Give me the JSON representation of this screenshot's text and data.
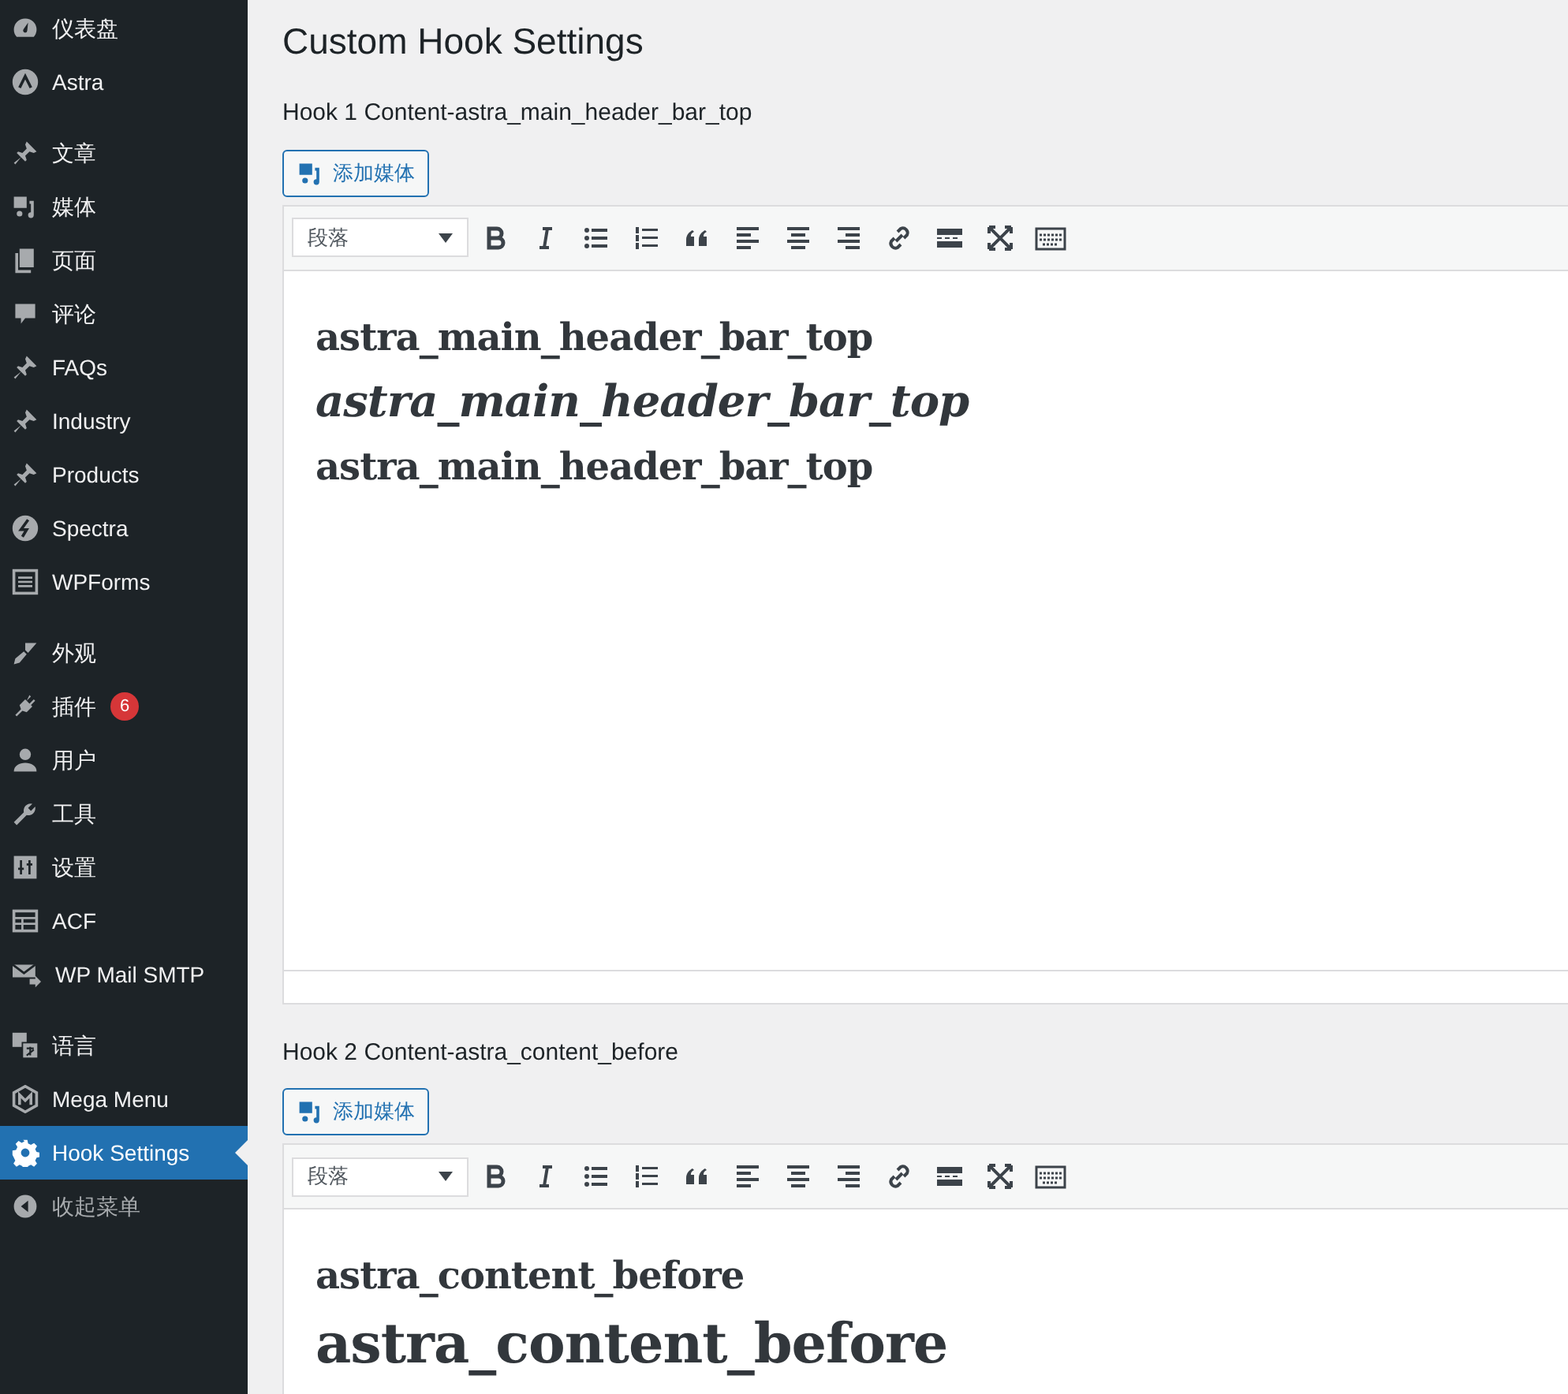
{
  "sidebar": {
    "menu_groups": [
      {
        "items": [
          {
            "label": "仪表盘",
            "selected": false
          },
          {
            "label": "Astra",
            "selected": false
          }
        ]
      },
      {
        "items": [
          {
            "label": "文章",
            "selected": false
          },
          {
            "label": "媒体",
            "selected": false
          },
          {
            "label": "页面",
            "selected": false
          },
          {
            "label": "评论",
            "selected": false
          },
          {
            "label": "FAQs",
            "selected": false
          },
          {
            "label": "Industry",
            "selected": false
          },
          {
            "label": "Products",
            "selected": false
          },
          {
            "label": "Spectra",
            "selected": false
          },
          {
            "label": "WPForms",
            "selected": false
          }
        ]
      },
      {
        "items": [
          {
            "label": "外观",
            "selected": false
          },
          {
            "label": "插件",
            "selected": false,
            "badge": "6"
          },
          {
            "label": "用户",
            "selected": false
          },
          {
            "label": "工具",
            "selected": false
          },
          {
            "label": "设置",
            "selected": false
          },
          {
            "label": "ACF",
            "selected": false
          },
          {
            "label": "WP Mail SMTP",
            "selected": false
          }
        ]
      },
      {
        "items": [
          {
            "label": "语言",
            "selected": false
          },
          {
            "label": "Mega Menu",
            "selected": false
          },
          {
            "label": "Hook Settings",
            "selected": true
          }
        ]
      }
    ],
    "collapse_label": "收起菜单"
  },
  "page": {
    "title": "Custom Hook Settings",
    "hooks": [
      {
        "label": "Hook 1 Content-astra_main_header_bar_top",
        "add_media": "添加媒体",
        "format": "段落",
        "paragraphs": [
          {
            "text": "astra_main_header_bar_top",
            "kind": "medium",
            "italic": false
          },
          {
            "text": "astra_main_header_bar_top",
            "kind": "large",
            "italic": true
          },
          {
            "text": "astra_main_header_bar_top",
            "kind": "medium",
            "italic": false
          }
        ]
      },
      {
        "label": "Hook 2 Content-astra_content_before",
        "add_media": "添加媒体",
        "format": "段落",
        "paragraphs": [
          {
            "text": "astra_content_before",
            "kind": "medium",
            "italic": false
          },
          {
            "text": "astra_content_before",
            "kind": "huge",
            "italic": false
          }
        ]
      }
    ]
  }
}
